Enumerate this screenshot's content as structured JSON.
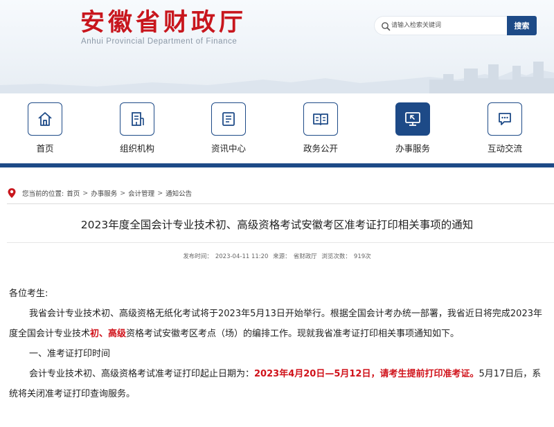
{
  "header": {
    "title": "安徽省财政厅",
    "subtitle": "Anhui Provincial Department of Finance",
    "search_placeholder": "请输入检索关键词",
    "search_button": "搜索"
  },
  "nav": {
    "items": [
      {
        "label": "首页",
        "icon": "home-icon",
        "active": false
      },
      {
        "label": "组织机构",
        "icon": "organization-icon",
        "active": false
      },
      {
        "label": "资讯中心",
        "icon": "news-icon",
        "active": false
      },
      {
        "label": "政务公开",
        "icon": "open-book-icon",
        "active": false
      },
      {
        "label": "办事服务",
        "icon": "monitor-service-icon",
        "active": true
      },
      {
        "label": "互动交流",
        "icon": "chat-icon",
        "active": false
      }
    ]
  },
  "breadcrumb": {
    "prefix": "您当前的位置:",
    "items": [
      "首页",
      "办事服务",
      "会计管理",
      "通知公告"
    ],
    "separator": ">"
  },
  "article": {
    "title": "2023年度全国会计专业技术初、高级资格考试安徽考区准考证打印相关事项的通知",
    "meta": {
      "publish_label": "发布时间：",
      "publish_time": "2023-04-11 11:20",
      "source_label": "来源：",
      "source": "省财政厅",
      "views_label": "浏览次数：",
      "views": "919次"
    },
    "greeting": "各位考生:",
    "para1_a": "我省会计专业技术初、高级资格无纸化考试将于2023年5月13日开始举行。根据全国会计考办统一部署，我省近日将完成2023年度全国会计专业技术",
    "para1_red": "初、高级",
    "para1_b": "资格考试安徽考区考点（场）的编排工作。现就我省准考证打印相关事项通知如下。",
    "section1": "一、准考证打印时间",
    "para2_a": "会计专业技术初、高级资格考试准考证打印起止日期为：",
    "para2_red": "2023年4月20日—5月12日，请考生提前打印准考证。",
    "para2_b": "5月17日后，系统将关闭准考证打印查询服务。"
  },
  "colors": {
    "brand_blue": "#1d4a87",
    "title_red": "#c8161d",
    "highlight_red": "#d0121a"
  }
}
